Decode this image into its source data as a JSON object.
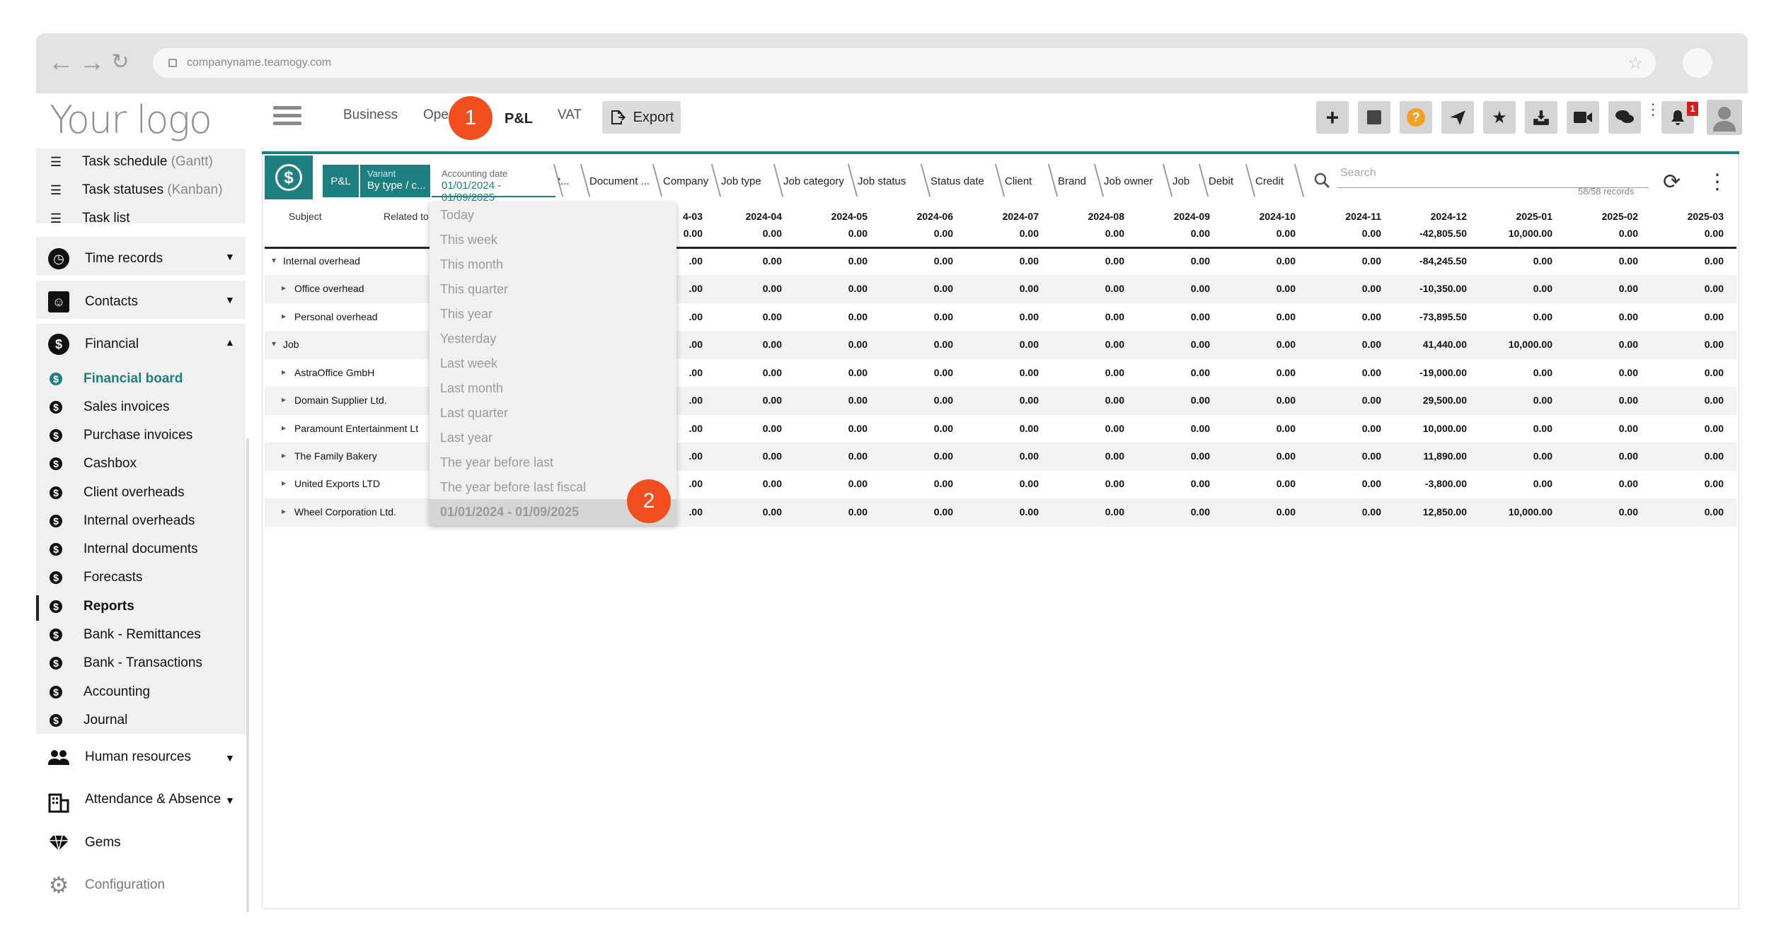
{
  "browser": {
    "url": "companyname.teamogy.com",
    "back_glyph": "←",
    "forward_glyph": "→",
    "reload_glyph": "↻",
    "star_glyph": "☆"
  },
  "app": {
    "logo_text": "Your logo",
    "top_nav": {
      "business": "Business",
      "operations": "Ope",
      "pl": "P&L",
      "vat": "VAT"
    },
    "export_label": "Export",
    "step_badges": [
      "1",
      "2"
    ],
    "notification_count": "1",
    "toolbar_icons": [
      "plus-icon",
      "note-icon",
      "help-icon",
      "send-icon",
      "star-icon",
      "inbox-icon",
      "video-icon",
      "chat-icon",
      "bell-icon",
      "user-icon"
    ]
  },
  "sidebar": {
    "items_top": [
      {
        "label": "Task schedule",
        "hint": "(Gantt)"
      },
      {
        "label": "Task statuses",
        "hint": "(Kanban)"
      },
      {
        "label": "Task list",
        "hint": ""
      }
    ],
    "time_records": "Time records",
    "contacts": "Contacts",
    "financial": "Financial",
    "financial_items": [
      "Financial board",
      "Sales invoices",
      "Purchase invoices",
      "Cashbox",
      "Client overheads",
      "Internal overheads",
      "Internal documents",
      "Forecasts",
      "Reports",
      "Bank - Remittances",
      "Bank - Transactions",
      "Accounting",
      "Journal"
    ],
    "human_resources": "Human resources",
    "attendance": "Attendance & Absence",
    "gems": "Gems",
    "configuration": "Configuration"
  },
  "board": {
    "filters": {
      "pl": "P&L",
      "variant_label": "Variant",
      "variant_value": "By type / c...",
      "acc_date_label": "Accounting date",
      "acc_date_value": "01/01/2024 - 01/09/2025",
      "cut": "t...",
      "document": "Document ...",
      "company": "Company",
      "job_type": "Job type",
      "job_category": "Job category",
      "job_status": "Job status",
      "status_date": "Status date",
      "client": "Client",
      "brand": "Brand",
      "job_owner": "Job owner",
      "job": "Job",
      "debit": "Debit",
      "credit": "Credit"
    },
    "search_placeholder": "Search",
    "records": "58/58 records",
    "col_subject": "Subject",
    "col_related": "Related to",
    "months": [
      "4-03",
      "2024-04",
      "2024-05",
      "2024-06",
      "2024-07",
      "2024-08",
      "2024-09",
      "2024-10",
      "2024-11",
      "2024-12",
      "2025-01",
      "2025-02",
      "2025-03"
    ],
    "totals": [
      "0.00",
      "0.00",
      "0.00",
      "0.00",
      "0.00",
      "0.00",
      "0.00",
      "0.00",
      "0.00",
      "-42,805.50",
      "10,000.00",
      "0.00",
      "0.00"
    ],
    "rows": [
      {
        "label": "Internal overhead",
        "expand": "▾",
        "values": [
          ".00",
          "0.00",
          "0.00",
          "0.00",
          "0.00",
          "0.00",
          "0.00",
          "0.00",
          "0.00",
          "-84,245.50",
          "0.00",
          "0.00",
          "0.00"
        ]
      },
      {
        "label": "Office overhead",
        "expand": "▸",
        "values": [
          ".00",
          "0.00",
          "0.00",
          "0.00",
          "0.00",
          "0.00",
          "0.00",
          "0.00",
          "0.00",
          "-10,350.00",
          "0.00",
          "0.00",
          "0.00"
        ]
      },
      {
        "label": "Personal overhead",
        "expand": "▸",
        "values": [
          ".00",
          "0.00",
          "0.00",
          "0.00",
          "0.00",
          "0.00",
          "0.00",
          "0.00",
          "0.00",
          "-73,895.50",
          "0.00",
          "0.00",
          "0.00"
        ]
      },
      {
        "label": "Job",
        "expand": "▾",
        "values": [
          ".00",
          "0.00",
          "0.00",
          "0.00",
          "0.00",
          "0.00",
          "0.00",
          "0.00",
          "0.00",
          "41,440.00",
          "10,000.00",
          "0.00",
          "0.00"
        ]
      },
      {
        "label": "AstraOffice GmbH",
        "expand": "▸",
        "values": [
          ".00",
          "0.00",
          "0.00",
          "0.00",
          "0.00",
          "0.00",
          "0.00",
          "0.00",
          "0.00",
          "-19,000.00",
          "0.00",
          "0.00",
          "0.00"
        ]
      },
      {
        "label": "Domain Supplier Ltd.",
        "expand": "▸",
        "values": [
          ".00",
          "0.00",
          "0.00",
          "0.00",
          "0.00",
          "0.00",
          "0.00",
          "0.00",
          "0.00",
          "29,500.00",
          "0.00",
          "0.00",
          "0.00"
        ]
      },
      {
        "label": "Paramount Entertainment Lt",
        "expand": "▸",
        "values": [
          ".00",
          "0.00",
          "0.00",
          "0.00",
          "0.00",
          "0.00",
          "0.00",
          "0.00",
          "0.00",
          "10,000.00",
          "0.00",
          "0.00",
          "0.00"
        ]
      },
      {
        "label": "The Family Bakery",
        "expand": "▸",
        "values": [
          ".00",
          "0.00",
          "0.00",
          "0.00",
          "0.00",
          "0.00",
          "0.00",
          "0.00",
          "0.00",
          "11,890.00",
          "0.00",
          "0.00",
          "0.00"
        ]
      },
      {
        "label": "United Exports LTD",
        "expand": "▸",
        "values": [
          ".00",
          "0.00",
          "0.00",
          "0.00",
          "0.00",
          "0.00",
          "0.00",
          "0.00",
          "0.00",
          "-3,800.00",
          "0.00",
          "0.00",
          "0.00"
        ]
      },
      {
        "label": "Wheel Corporation Ltd.",
        "expand": "▸",
        "values": [
          ".00",
          "0.00",
          "0.00",
          "0.00",
          "0.00",
          "0.00",
          "0.00",
          "0.00",
          "0.00",
          "12,850.00",
          "10,000.00",
          "0.00",
          "0.00"
        ]
      }
    ],
    "date_options": [
      "Today",
      "This week",
      "This month",
      "This quarter",
      "This year",
      "Yesterday",
      "Last week",
      "Last month",
      "Last quarter",
      "Last year",
      "The year before last",
      "The year before last fiscal"
    ],
    "date_selected": "01/01/2024 - 01/09/2025"
  }
}
